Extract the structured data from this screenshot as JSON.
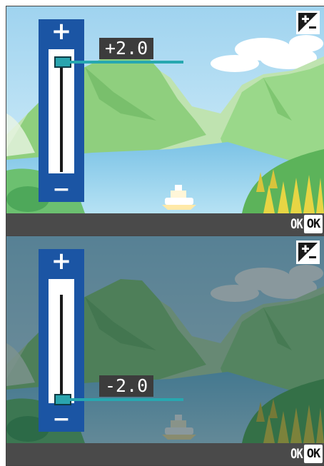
{
  "screens": [
    {
      "id": "top",
      "ev_value": "+2.0",
      "level": 1.0,
      "slider_plus": "+",
      "slider_minus": "−",
      "status_text": "OK",
      "ok_button": "OK",
      "icon": "exposure-compensation-icon",
      "dimmed": false
    },
    {
      "id": "bottom",
      "ev_value": "-2.0",
      "level": 0.0,
      "slider_plus": "+",
      "slider_minus": "−",
      "status_text": "OK",
      "ok_button": "OK",
      "icon": "exposure-compensation-icon",
      "dimmed": true
    }
  ],
  "colors": {
    "slider_blue": "#1b55a4",
    "knob": "#2aa4ae",
    "statusbar": "#4a4a4a"
  }
}
